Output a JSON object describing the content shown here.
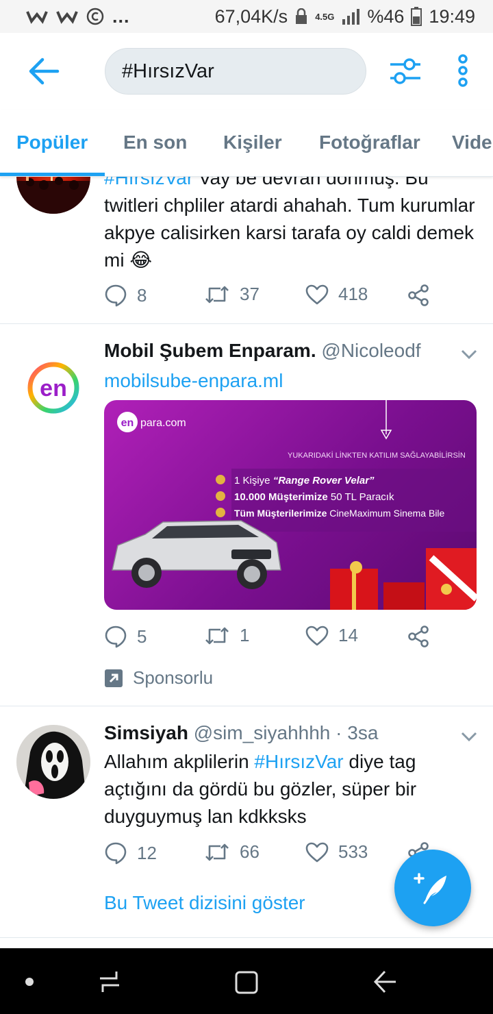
{
  "status_bar": {
    "left_icons": [
      "w-icon",
      "w-icon",
      "copyright-icon"
    ],
    "ellipsis": "...",
    "speed": "67,04K/s",
    "network": "4.5G",
    "battery": "%46",
    "time": "19:49"
  },
  "header": {
    "search_value": "#HırsızVar"
  },
  "tabs": [
    "Popüler",
    "En son",
    "Kişiler",
    "Fotoğraflar",
    "Vide"
  ],
  "tweets": [
    {
      "hashtag": "#HırsızVar",
      "line1_rest": " Vay be devran dönmüş. Bu",
      "text": "twitleri chpliler atardi ahahah. Tum kurumlar akpye calisirken karsi tarafa oy caldi demek mi",
      "emoji": "😂",
      "replies": "8",
      "retweets": "37",
      "likes": "418"
    },
    {
      "name": "Mobil Şubem Enparam.",
      "handle": "@Nicoleodf",
      "link": "mobilsube-enpara.ml",
      "ad": {
        "brand": "para.com",
        "brand_badge": "en",
        "avatar_text": "en",
        "headline": "YUKARIDAKİ LİNKTEN KATILIM SAĞLAYABİLİRSİN",
        "line1_a": "1 Kişiye ",
        "line1_b": "“Range Rover Velar”",
        "line2_a": "10.000 Müşterimize",
        "line2_b": " 50 TL Paracık",
        "line3_a": "Tüm Müşterilerimize",
        "line3_b": " CineMaximum Sinema Bile"
      },
      "replies": "5",
      "retweets": "1",
      "likes": "14",
      "sponsored": "Sponsorlu"
    },
    {
      "name": "Simsiyah",
      "handle": "@sim_siyahhhh",
      "time": " · 3sa",
      "text_a": "Allahım akplilerin ",
      "hashtag": "#HırsızVar",
      "text_b": " diye tag açtığını da gördü bu gözler, süper bir duyguymuş lan kdkksks",
      "replies": "12",
      "retweets": "66",
      "likes": "533",
      "show_thread": "Bu Tweet dizisini göster"
    }
  ],
  "colors": {
    "accent": "#1da1f2",
    "text": "#14171a",
    "muted": "#657786",
    "divider": "#e1e8ed"
  }
}
